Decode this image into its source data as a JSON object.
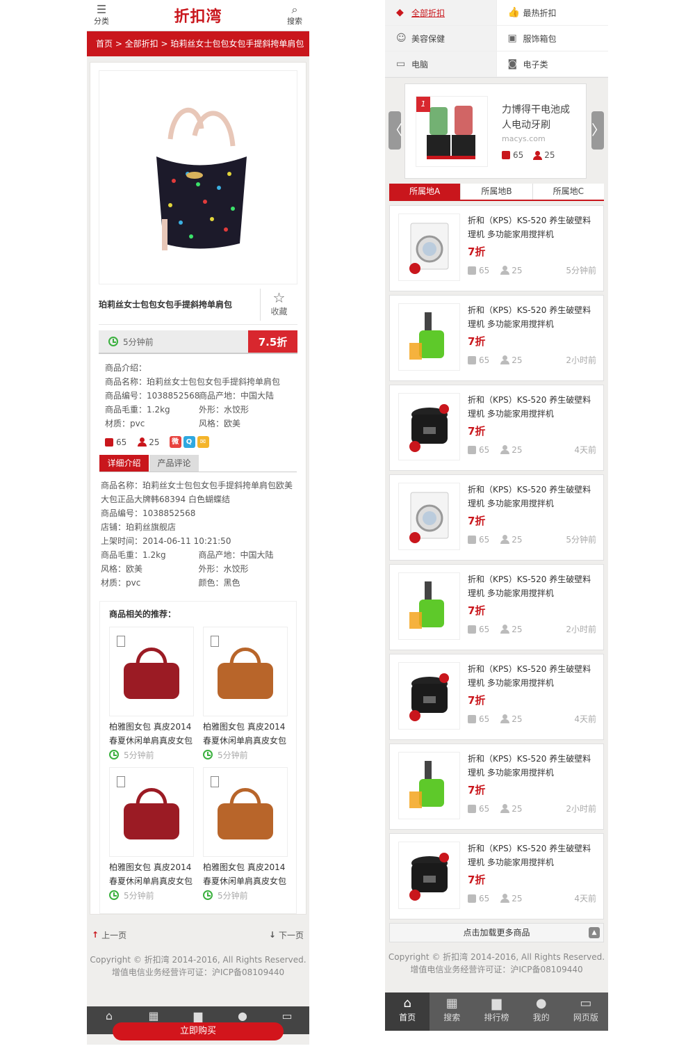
{
  "left": {
    "header": {
      "menu_label": "分类",
      "logo": "折扣湾",
      "search_label": "搜索"
    },
    "breadcrumb": "首页 > 全部折扣 > 珀莉丝女士包包女包手提斜挎单肩包",
    "product": {
      "title": "珀莉丝女士包包女包手提斜挎单肩包",
      "fav_label": "收藏",
      "time": "5分钟前",
      "discount": "7.5折",
      "intro_heading": "商品介绍：",
      "intro_name": "商品名称：珀莉丝女士包包女包手提斜挎单肩包",
      "intro_grid": [
        "商品编号：1038852568",
        "商品产地：中国大陆",
        "商品毛重：1.2kg",
        "外形：水饺形",
        "材质：pvc",
        "风格：欧美"
      ],
      "likes": "65",
      "followers": "25"
    },
    "tabs": [
      "详细介绍",
      "产品评论"
    ],
    "detail": {
      "lines": [
        "商品名称：珀莉丝女士包包女包手提斜挎单肩包欧美大包正品大牌韩68394 白色蝴蝶结",
        "商品编号：1038852568",
        "店铺：珀莉丝旗舰店",
        "上架时间：2014-06-11 10:21:50"
      ],
      "grid": [
        "商品毛重：1.2kg",
        "商品产地：中国大陆",
        "风格：欧美",
        "外形：水饺形",
        "材质：pvc",
        "颜色：黑色"
      ]
    },
    "recommend": {
      "heading": "商品相关的推荐：",
      "items": [
        {
          "name1": "柏雅图女包 真皮2014",
          "name2": "春夏休闲单肩真皮女包",
          "time": "5分钟前",
          "color": "#9b1b24"
        },
        {
          "name1": "柏雅图女包 真皮2014",
          "name2": "春夏休闲单肩真皮女包",
          "time": "5分钟前",
          "color": "#b8652a"
        },
        {
          "name1": "柏雅图女包 真皮2014",
          "name2": "春夏休闲单肩真皮女包",
          "time": "5分钟前",
          "color": "#9b1b24"
        },
        {
          "name1": "柏雅图女包 真皮2014",
          "name2": "春夏休闲单肩真皮女包",
          "time": "5分钟前",
          "color": "#b8652a"
        }
      ]
    },
    "pager": {
      "prev": "上一页",
      "next": "下一页"
    },
    "copyright1": "Copyright © 折扣湾 2014-2016, All Rights Reserved.",
    "copyright2": "增值电信业务经营许可证：沪ICP备08109440",
    "buy_label": "立即购买"
  },
  "right": {
    "categories": [
      {
        "label": "全部折扣",
        "icon": "tag-icon"
      },
      {
        "label": "最热折扣",
        "icon": "thumb-icon"
      },
      {
        "label": "美容保健",
        "icon": "face-icon"
      },
      {
        "label": "服饰箱包",
        "icon": "bag-icon"
      },
      {
        "label": "电脑",
        "icon": "laptop-icon"
      },
      {
        "label": "电子类",
        "icon": "camera-icon"
      }
    ],
    "slide": {
      "rank": "1",
      "name": "力博得干电池成人电动牙刷",
      "source": "macys.com",
      "likes": "65",
      "followers": "25"
    },
    "region_tabs": [
      "所属地A",
      "所属地B",
      "所属地C"
    ],
    "products": [
      {
        "name": "折和（KPS）KS-520 养生破壁料理机 多功能家用搅拌机",
        "discount": "7折",
        "likes": "65",
        "followers": "25",
        "ago": "5分钟前",
        "kind": "washer"
      },
      {
        "name": "折和（KPS）KS-520 养生破壁料理机 多功能家用搅拌机",
        "discount": "7折",
        "likes": "65",
        "followers": "25",
        "ago": "2小时前",
        "kind": "juicer"
      },
      {
        "name": "折和（KPS）KS-520 养生破壁料理机 多功能家用搅拌机",
        "discount": "7折",
        "likes": "65",
        "followers": "25",
        "ago": "4天前",
        "kind": "cooker"
      },
      {
        "name": "折和（KPS）KS-520 养生破壁料理机 多功能家用搅拌机",
        "discount": "7折",
        "likes": "65",
        "followers": "25",
        "ago": "5分钟前",
        "kind": "washer"
      },
      {
        "name": "折和（KPS）KS-520 养生破壁料理机 多功能家用搅拌机",
        "discount": "7折",
        "likes": "65",
        "followers": "25",
        "ago": "2小时前",
        "kind": "juicer"
      },
      {
        "name": "折和（KPS）KS-520 养生破壁料理机 多功能家用搅拌机",
        "discount": "7折",
        "likes": "65",
        "followers": "25",
        "ago": "4天前",
        "kind": "cooker"
      },
      {
        "name": "折和（KPS）KS-520 养生破壁料理机 多功能家用搅拌机",
        "discount": "7折",
        "likes": "65",
        "followers": "25",
        "ago": "2小时前",
        "kind": "juicer"
      },
      {
        "name": "折和（KPS）KS-520 养生破壁料理机 多功能家用搅拌机",
        "discount": "7折",
        "likes": "65",
        "followers": "25",
        "ago": "4天前",
        "kind": "cooker"
      }
    ],
    "load_more": "点击加载更多商品",
    "copyright1": "Copyright © 折扣湾 2014-2016, All Rights Reserved.",
    "copyright2": "增值电信业务经营许可证：沪ICP备08109440",
    "nav": [
      {
        "label": "首页",
        "icon": "home-icon"
      },
      {
        "label": "搜索",
        "icon": "grid-icon"
      },
      {
        "label": "排行榜",
        "icon": "podium-icon"
      },
      {
        "label": "我的",
        "icon": "user-icon"
      },
      {
        "label": "网页版",
        "icon": "monitor-icon"
      }
    ]
  },
  "colors": {
    "brand_red": "#c9161c",
    "discount_red": "#d8272e",
    "time_green": "#3ab03e"
  }
}
